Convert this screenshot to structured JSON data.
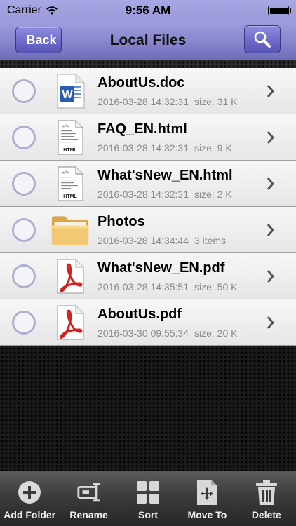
{
  "status": {
    "carrier": "Carrier",
    "time": "9:56 AM"
  },
  "nav": {
    "back_label": "Back",
    "title": "Local Files"
  },
  "files": [
    {
      "name": "AboutUs.doc",
      "date": "2016-03-28 14:32:31",
      "size": "size: 31 K",
      "icon": "word-doc-icon"
    },
    {
      "name": "FAQ_EN.html",
      "date": "2016-03-28 14:32:31",
      "size": "size: 9 K",
      "icon": "html-file-icon"
    },
    {
      "name": "What'sNew_EN.html",
      "date": "2016-03-28 14:32:31",
      "size": "size: 2 K",
      "icon": "html-file-icon"
    },
    {
      "name": "Photos",
      "date": "2016-03-28 14:34:44",
      "size": "3 items",
      "icon": "folder-icon"
    },
    {
      "name": "What'sNew_EN.pdf",
      "date": "2016-03-28 14:35:51",
      "size": "size: 50 K",
      "icon": "pdf-file-icon"
    },
    {
      "name": "AboutUs.pdf",
      "date": "2016-03-30 09:55:34",
      "size": "size: 20 K",
      "icon": "pdf-file-icon"
    }
  ],
  "toolbar": {
    "add_folder": "Add Folder",
    "rename": "Rename",
    "sort": "Sort",
    "move_to": "Move To",
    "delete": "Delete"
  },
  "colors": {
    "nav_accent": "#8785cc",
    "select_ring": "#aeb0d3"
  }
}
